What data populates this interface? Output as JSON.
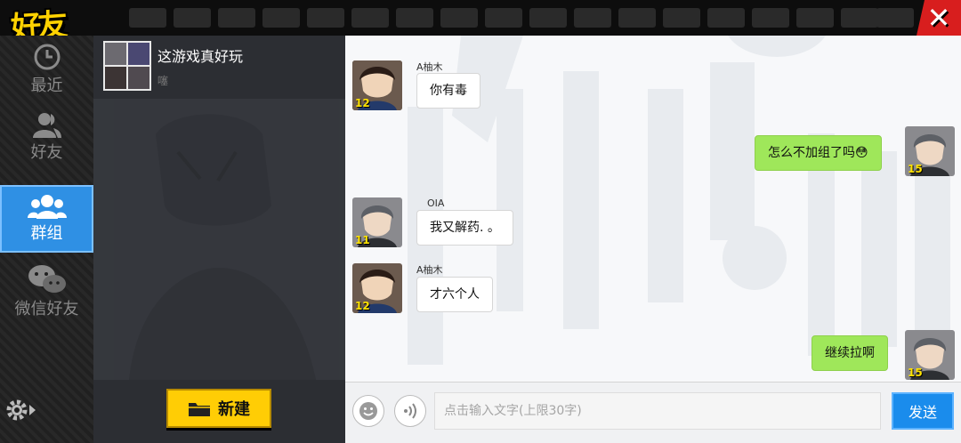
{
  "app": {
    "logo_text": "好友",
    "close_symbol": "✕"
  },
  "sidebar": {
    "items": [
      {
        "label": "最近",
        "icon": "clock-icon",
        "active": false
      },
      {
        "label": "好友",
        "icon": "person-icon",
        "active": false
      },
      {
        "label": "群组",
        "icon": "group-icon",
        "active": true
      },
      {
        "label": "微信好友",
        "icon": "wechat-icon",
        "active": false
      }
    ],
    "settings_icon": "gear-icon"
  },
  "group_list": {
    "items": [
      {
        "name": "这游戏真好玩",
        "preview": "噻"
      }
    ],
    "new_button_label": "新建"
  },
  "chat": {
    "messages": [
      {
        "sender": "A柚木",
        "text": "你有毒",
        "level": "12",
        "mine": false
      },
      {
        "sender": "",
        "text": "怎么不加组了吗😳",
        "level": "15",
        "mine": true
      },
      {
        "sender": "OIA",
        "text": "我又解药. 。",
        "level": "11",
        "mine": false
      },
      {
        "sender": "A柚木",
        "text": "才六个人",
        "level": "12",
        "mine": false
      },
      {
        "sender": "",
        "text": "继续拉啊",
        "level": "15",
        "mine": true
      }
    ]
  },
  "input_bar": {
    "placeholder": "点击输入文字(上限30字)",
    "send_label": "发送",
    "emoji_icon": "smiley-icon",
    "voice_icon": "voice-icon"
  },
  "colors": {
    "accent_blue": "#2f90e4",
    "my_bubble": "#9fe75a",
    "new_button": "#ffcd05",
    "close_red": "#d81e1e",
    "level_yellow": "#ffe200"
  }
}
